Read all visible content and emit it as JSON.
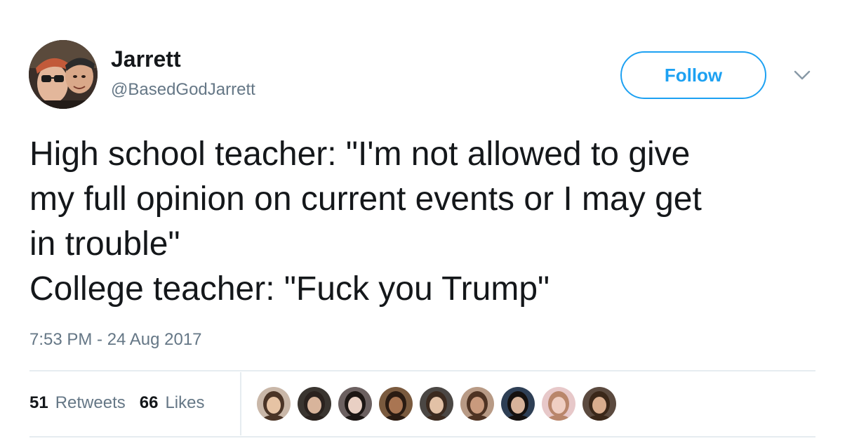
{
  "user": {
    "name": "Jarrett",
    "handle": "@BasedGodJarrett"
  },
  "follow_label": "Follow",
  "tweet": {
    "lines": [
      "High school teacher: \"I'm not allowed to give",
      "my full opinion on current events or I may get",
      "in trouble\"",
      "College teacher: \"Fuck you Trump\""
    ],
    "timestamp": "7:53 PM - 24 Aug 2017"
  },
  "stats": {
    "retweets_count": "51",
    "retweets_label": "Retweets",
    "likes_count": "66",
    "likes_label": "Likes"
  },
  "colors": {
    "accent": "#1da1f2",
    "text": "#14171a",
    "muted": "#657786",
    "divider": "#e6ecf0"
  },
  "liker_avatars": [
    {
      "bg": "#c9b7a8",
      "face": "#e6c3a4",
      "hair": "#4a3426"
    },
    {
      "bg": "#3a3530",
      "face": "#d8b49b",
      "hair": "#2a221e"
    },
    {
      "bg": "#6b6060",
      "face": "#e9d0c4",
      "hair": "#1c1614"
    },
    {
      "bg": "#7a5a3e",
      "face": "#a97552",
      "hair": "#2a1b12"
    },
    {
      "bg": "#4b4744",
      "face": "#e2c1a6",
      "hair": "#3b2a1f"
    },
    {
      "bg": "#b89a85",
      "face": "#c99a7d",
      "hair": "#4e3323"
    },
    {
      "bg": "#2e3f55",
      "face": "#d7b39a",
      "hair": "#15110f"
    },
    {
      "bg": "#e7c8c9",
      "face": "#f0cfc3",
      "hair": "#b9866b"
    },
    {
      "bg": "#5b4a3f",
      "face": "#d9ad8e",
      "hair": "#3a2719"
    }
  ]
}
